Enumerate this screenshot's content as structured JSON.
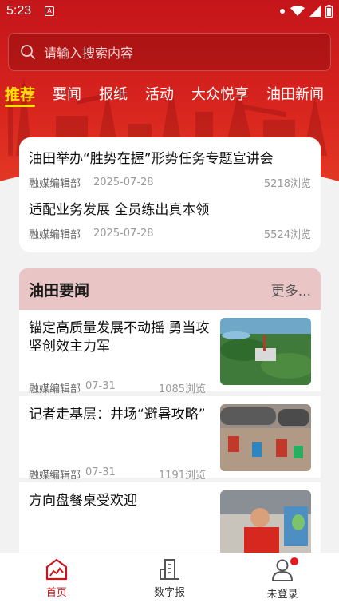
{
  "status_bar": {
    "time": "5:23",
    "notification_glyph": "A"
  },
  "search": {
    "placeholder": "请输入搜索内容"
  },
  "tabs": [
    {
      "label": "推荐",
      "active": true
    },
    {
      "label": "要闻",
      "active": false
    },
    {
      "label": "报纸",
      "active": false
    },
    {
      "label": "活动",
      "active": false
    },
    {
      "label": "大众悦享",
      "active": false
    },
    {
      "label": "油田新闻",
      "active": false
    }
  ],
  "top_news": [
    {
      "title": "油田举办“胜势在握”形势任务专题宣讲会",
      "source": "融媒编辑部",
      "date": "2025-07-28",
      "views": "5218浏览"
    },
    {
      "title": "适配业务发展 全员练出真本领",
      "source": "融媒编辑部",
      "date": "2025-07-28",
      "views": "5524浏览"
    }
  ],
  "section": {
    "title": "油田要闻",
    "more": "更多..."
  },
  "news": [
    {
      "title": "锚定高质量发展不动摇 勇当攻坚创效主力军",
      "source": "融媒编辑部",
      "date": "07-31",
      "views": "1085浏览"
    },
    {
      "title": "记者走基层：井场“避暑攻略”",
      "source": "融媒编辑部",
      "date": "07-31",
      "views": "1191浏览"
    },
    {
      "title": "方向盘餐桌受欢迎",
      "source": "",
      "date": "",
      "views": ""
    }
  ],
  "bottom_nav": [
    {
      "label": "首页",
      "icon": "home-icon",
      "active": true
    },
    {
      "label": "数字报",
      "icon": "building-icon",
      "active": false
    },
    {
      "label": "未登录",
      "icon": "user-icon",
      "active": false,
      "badge": true
    }
  ],
  "colors": {
    "brand_red": "#c8161d",
    "tab_active": "#ffe000",
    "section_header": "#e9c5c5"
  }
}
